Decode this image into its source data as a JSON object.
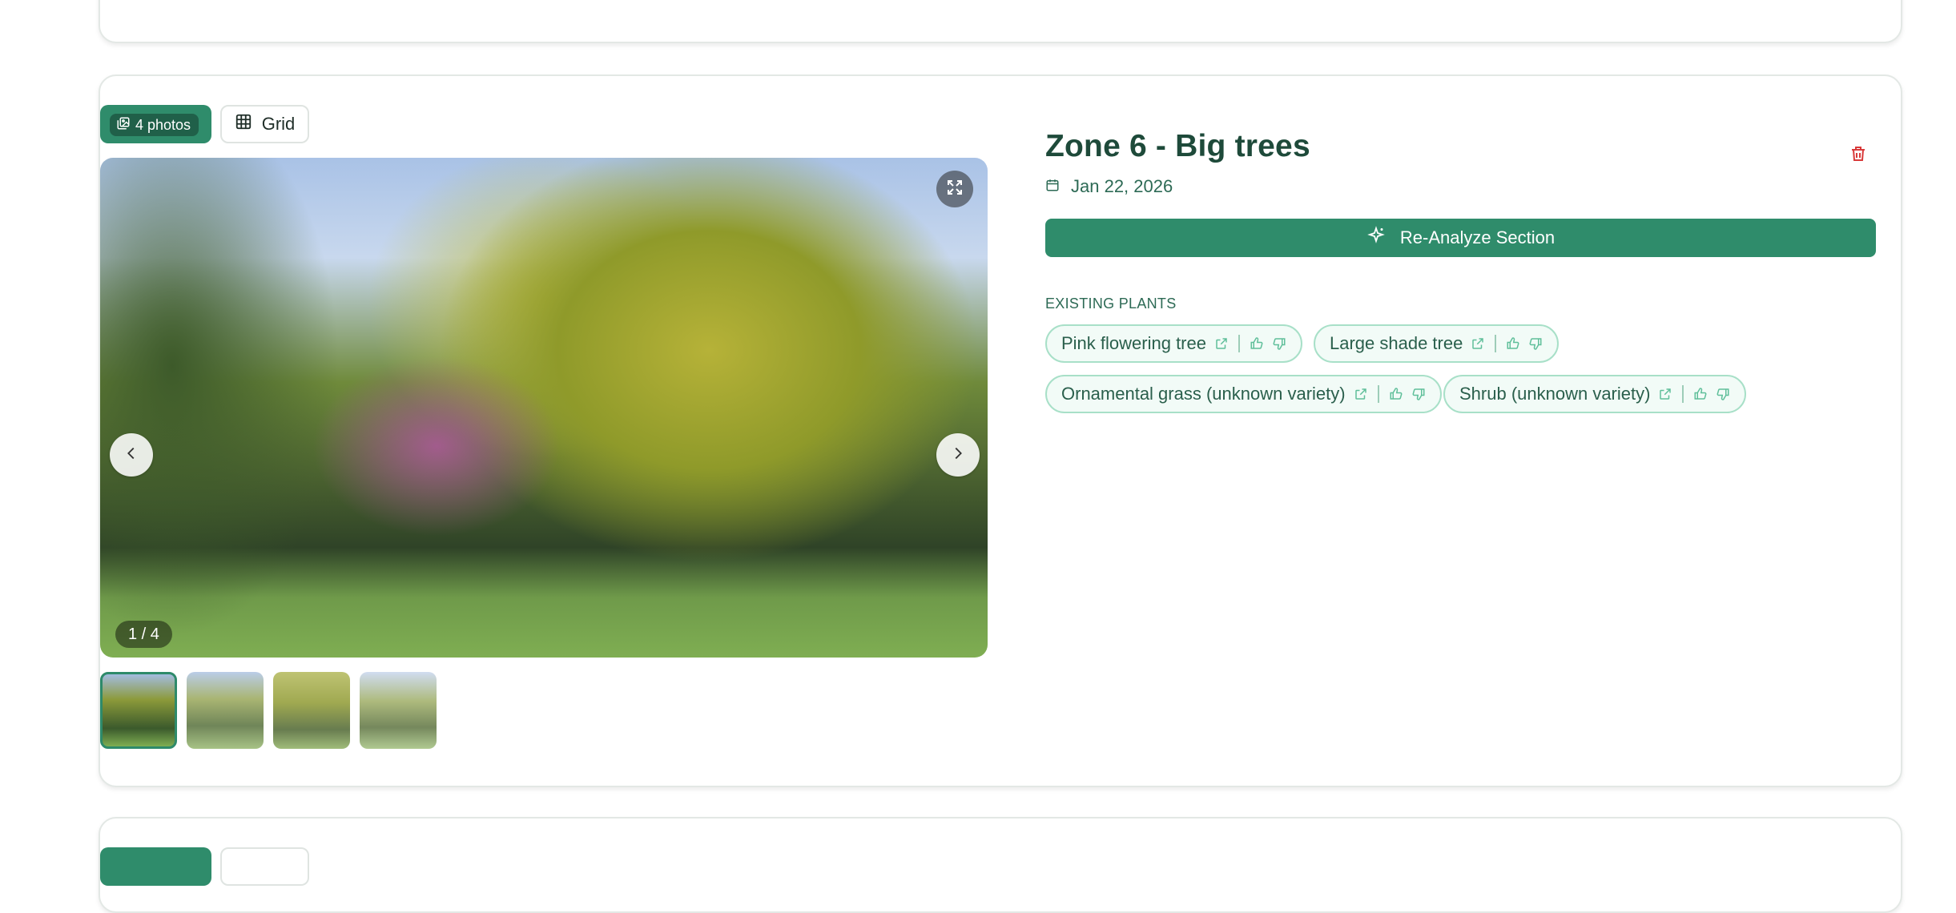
{
  "section": {
    "photos_badge": "4 photos",
    "grid_button": "Grid",
    "photo_counter": "1 / 4",
    "title": "Zone 6 - Big trees",
    "date": "Jan 22, 2026",
    "reanalyze_label": "Re-Analyze Section",
    "existing_plants_label": "EXISTING PLANTS",
    "plants": [
      {
        "name": "Pink flowering tree"
      },
      {
        "name": "Large shade tree"
      },
      {
        "name": "Ornamental grass (unknown variety)"
      },
      {
        "name": "Shrub (unknown variety)"
      }
    ]
  },
  "colors": {
    "accent": "#2f8c6b",
    "title": "#1e4a3a",
    "pill_border": "#a8e0c8",
    "pill_bg": "#f2fbf7",
    "delete": "#d93a3a"
  },
  "icons": {
    "photos": "images-icon",
    "grid": "grid-icon",
    "calendar": "calendar-icon",
    "delete": "trash-icon",
    "reanalyze": "sparkles-icon",
    "expand": "expand-icon",
    "prev": "chevron-left-icon",
    "next": "chevron-right-icon",
    "plant_link": "external-link-icon",
    "like": "thumbs-up-icon",
    "dislike": "thumbs-down-icon"
  }
}
